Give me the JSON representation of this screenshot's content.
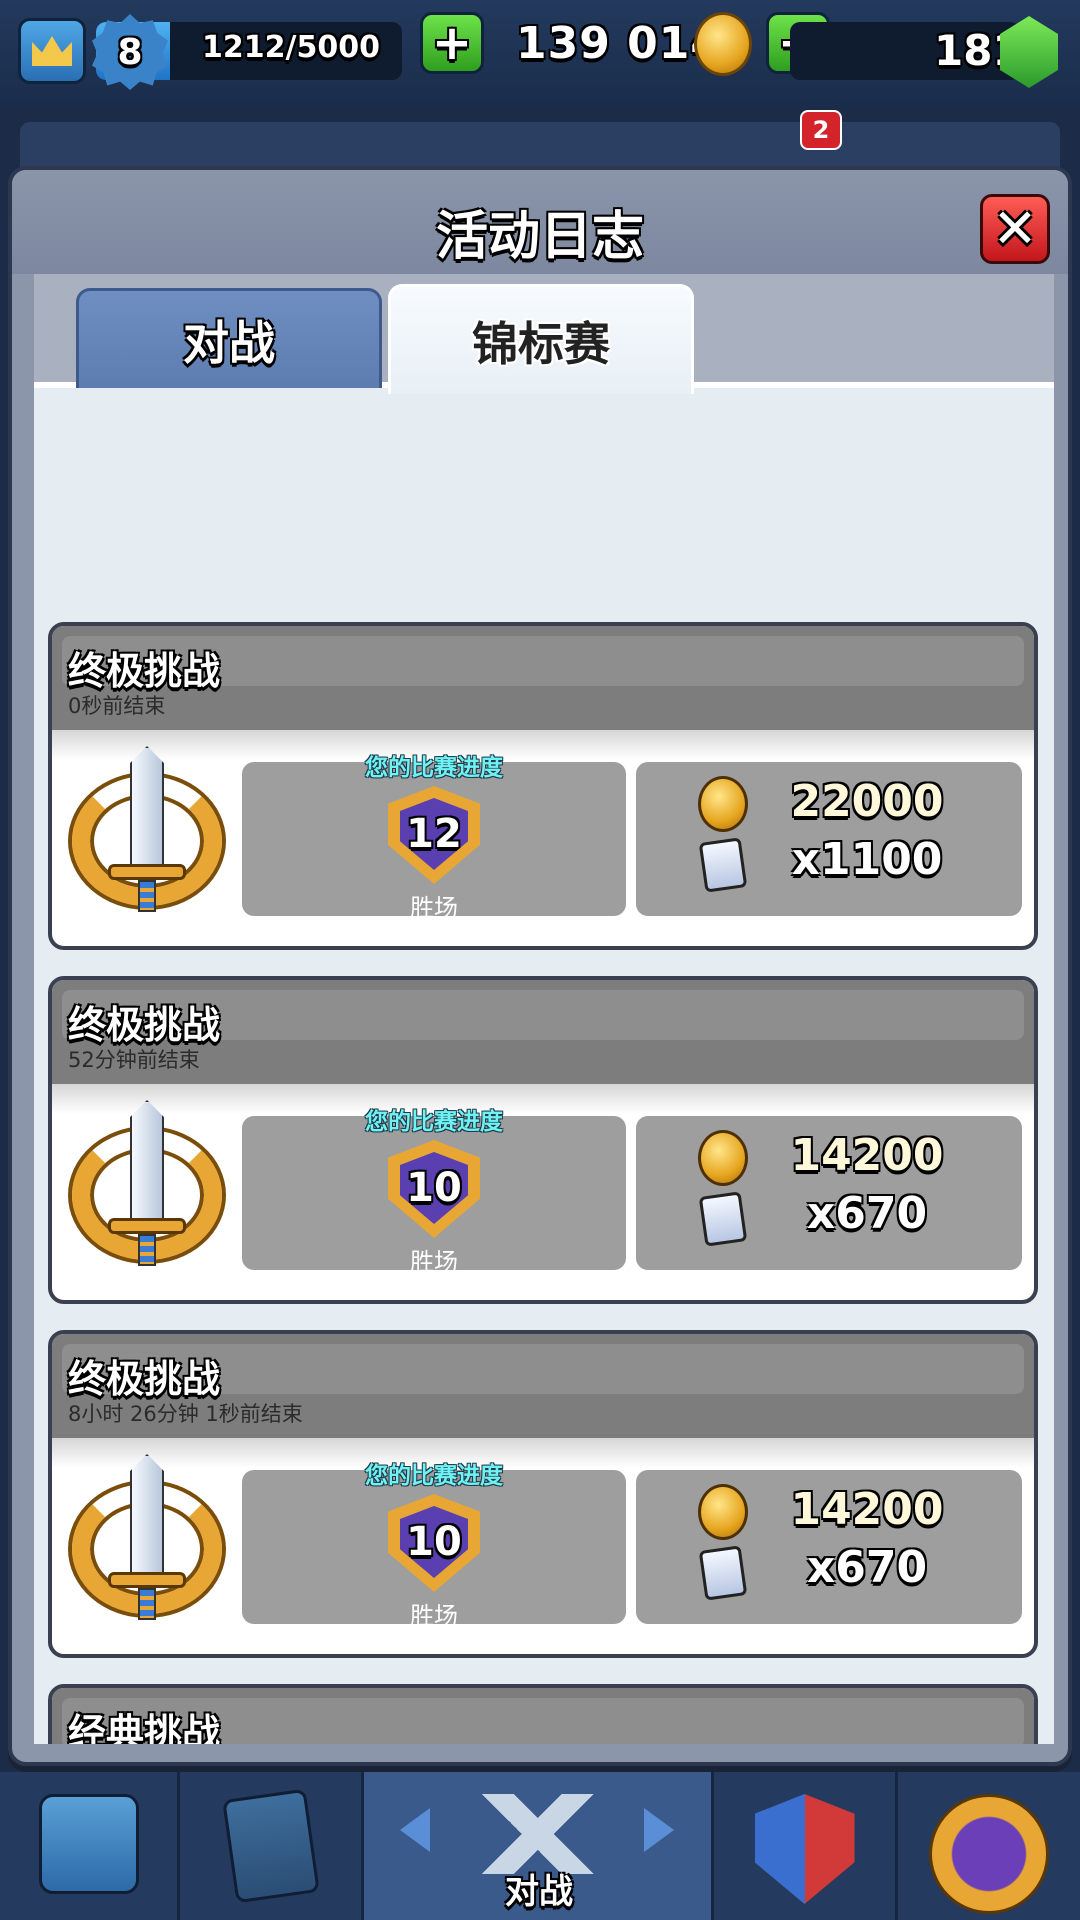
{
  "hud": {
    "level": "8",
    "xp": "1212/5000",
    "xp_progress": 0.2424,
    "gold": "139 014",
    "gems": "181",
    "notification_count": "2"
  },
  "modal": {
    "title": "活动日志",
    "tabs": [
      {
        "label": "对战",
        "active": false
      },
      {
        "label": "锦标赛",
        "active": true
      }
    ]
  },
  "entries": [
    {
      "title": "终极挑战",
      "ended": "0秒前结束",
      "progress_label": "您的比赛进度",
      "wins": "12",
      "wins_label": "胜场",
      "gold": "22000",
      "cards": "x1100"
    },
    {
      "title": "终极挑战",
      "ended": "52分钟前结束",
      "progress_label": "您的比赛进度",
      "wins": "10",
      "wins_label": "胜场",
      "gold": "14200",
      "cards": "x670"
    },
    {
      "title": "终极挑战",
      "ended": "8小时 26分钟 1秒前结束",
      "progress_label": "您的比赛进度",
      "wins": "10",
      "wins_label": "胜场",
      "gold": "14200",
      "cards": "x670"
    },
    {
      "title": "经典挑战"
    }
  ],
  "bottom_nav": {
    "active_label": "对战"
  },
  "colors": {
    "progress_text": "#6ff2f4",
    "close_button": "#d4242b",
    "tab_active": "#f7fbff",
    "tab_inactive": "#6f8fc2"
  }
}
